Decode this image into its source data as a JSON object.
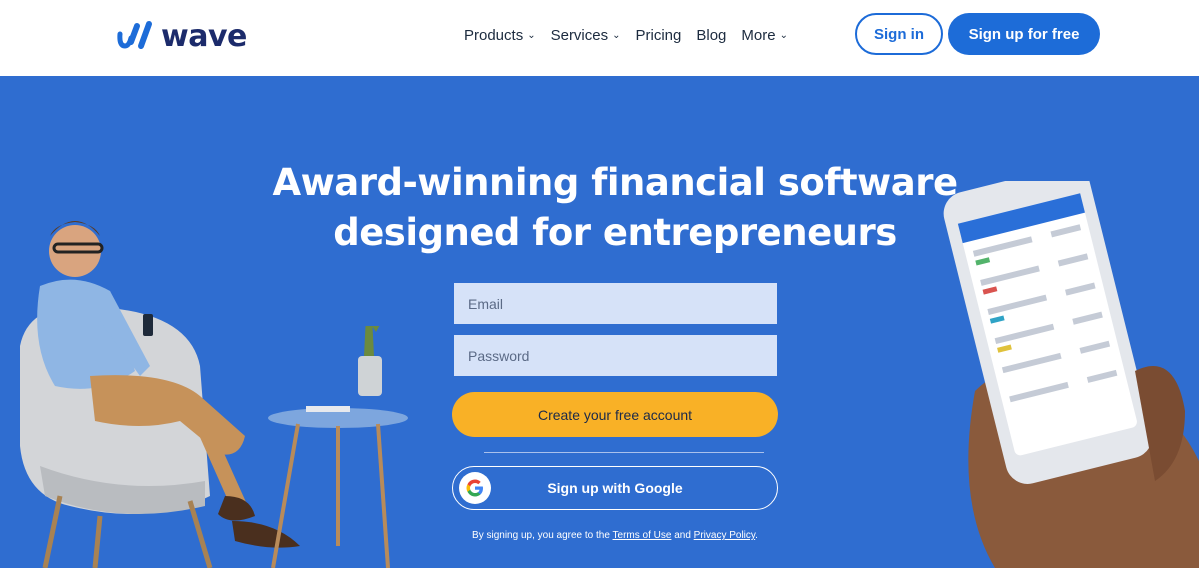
{
  "brand": {
    "name": "wave"
  },
  "nav": {
    "items": [
      {
        "label": "Products",
        "has_dropdown": true
      },
      {
        "label": "Services",
        "has_dropdown": true
      },
      {
        "label": "Pricing",
        "has_dropdown": false
      },
      {
        "label": "Blog",
        "has_dropdown": false
      },
      {
        "label": "More",
        "has_dropdown": true
      }
    ],
    "signin_label": "Sign in",
    "signup_label": "Sign up for free"
  },
  "hero": {
    "headline_line1": "Award-winning financial software",
    "headline_line2": "designed for entrepreneurs",
    "email_placeholder": "Email",
    "password_placeholder": "Password",
    "create_account_label": "Create your free account",
    "google_label": "Sign up with Google",
    "legal_prefix": "By signing up, you agree to the",
    "terms_label": "Terms of Use",
    "legal_and": "and",
    "privacy_label": "Privacy Policy",
    "legal_suffix": "."
  },
  "colors": {
    "hero_bg": "#2f6dd0",
    "primary_blue": "#1d6cd8",
    "cta_yellow": "#f9b126",
    "brand_navy": "#1c2b6b"
  },
  "icons": [
    "wave-logo-icon",
    "chevron-down-icon",
    "google-g-icon"
  ]
}
